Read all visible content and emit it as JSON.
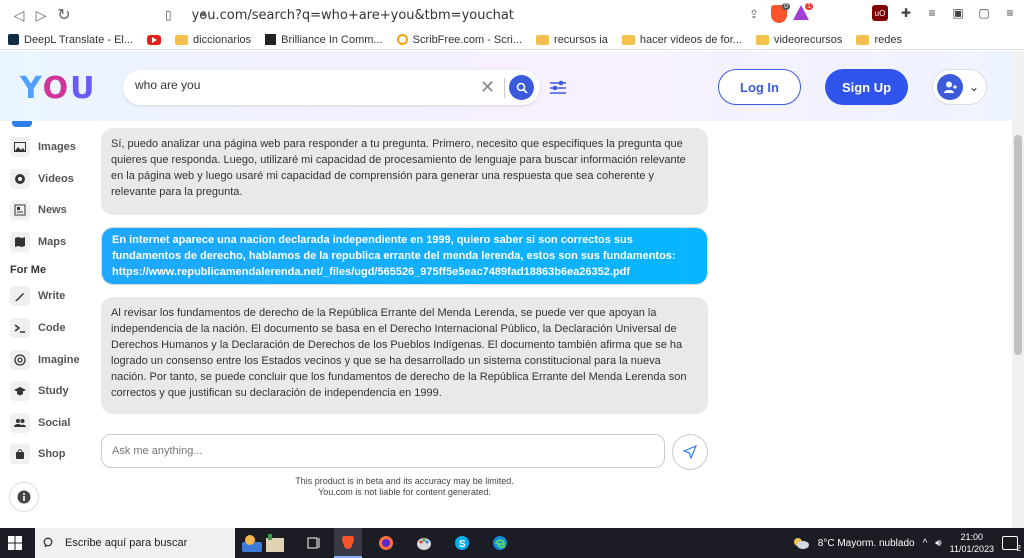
{
  "browser": {
    "url": "you.com/search?q=who+are+you&tbm=youchat",
    "bookmarks": [
      {
        "label": "DeepL Translate - El...",
        "icon": "deepl-icon"
      },
      {
        "label": "",
        "icon": "youtube-icon"
      },
      {
        "label": "diccionarios",
        "icon": "folder-icon"
      },
      {
        "label": "Brilliance In Comm...",
        "icon": "brilliance-icon"
      },
      {
        "label": "ScribFree.com - Scri...",
        "icon": "scribfree-icon"
      },
      {
        "label": "recursos ia",
        "icon": "folder-icon"
      },
      {
        "label": "hacer videos de for...",
        "icon": "folder-icon"
      },
      {
        "label": "videorecursos",
        "icon": "folder-icon"
      },
      {
        "label": "redes",
        "icon": "folder-icon"
      }
    ],
    "brave_badge": "0",
    "alert_badge": "1"
  },
  "header": {
    "logo": {
      "y": "Y",
      "o": "O",
      "u": "U"
    },
    "search_value": "who are you",
    "login_label": "Log In",
    "signup_label": "Sign Up"
  },
  "sidebar": {
    "items_top": [
      {
        "label": "Images",
        "icon": "image-icon"
      },
      {
        "label": "Videos",
        "icon": "video-icon"
      },
      {
        "label": "News",
        "icon": "news-icon"
      },
      {
        "label": "Maps",
        "icon": "map-icon"
      }
    ],
    "section_label": "For Me",
    "items_me": [
      {
        "label": "Write",
        "icon": "pencil-icon"
      },
      {
        "label": "Code",
        "icon": "terminal-icon"
      },
      {
        "label": "Imagine",
        "icon": "spiral-icon"
      },
      {
        "label": "Study",
        "icon": "graduation-cap-icon"
      },
      {
        "label": "Social",
        "icon": "people-icon"
      },
      {
        "label": "Shop",
        "icon": "shopping-bag-icon"
      }
    ]
  },
  "chat": {
    "messages": [
      {
        "role": "ai",
        "text": "Sí, puedo analizar una página web para responder a tu pregunta. Primero, necesito que especifiques la pregunta que quieres que responda. Luego, utilizaré mi capacidad de procesamiento de lenguaje para buscar información relevante en la página web y luego usaré mi capacidad de comprensión para generar una respuesta que sea coherente y relevante para la pregunta."
      },
      {
        "role": "user",
        "text": "En internet aparece una nacion declarada independiente en 1999, quiero saber si son correctos sus fundamentos de derecho, hablamos de la republica errante del menda lerenda, estos son sus fundamentos: https://www.republicamendalerenda.net/_files/ugd/565526_975ff5e5eac7489fad18863b6ea26352.pdf"
      },
      {
        "role": "ai",
        "text": "Al revisar los fundamentos de derecho de la República Errante del Menda Lerenda, se puede ver que apoyan la independencia de la nación. El documento se basa en el Derecho Internacional Público, la Declaración Universal de Derechos Humanos y la Declaración de Derechos de los Pueblos Indígenas. El documento también afirma que se ha logrado un consenso entre los Estados vecinos y que se ha desarrollado un sistema constitucional para la nueva nación. Por tanto, se puede concluir que los fundamentos de derecho de la República Errante del Menda Lerenda son correctos y que justifican su declaración de independencia en 1999."
      }
    ],
    "input_placeholder": "Ask me anything...",
    "disclaimer_line1": "This product is in beta and its accuracy may be limited.",
    "disclaimer_line2": "You.com is not liable for content generated."
  },
  "taskbar": {
    "search_placeholder": "Escribe aquí para buscar",
    "weather": "8°C  Mayorm. nublado",
    "time": "21:00",
    "date": "11/01/2023",
    "notifications": "2"
  }
}
